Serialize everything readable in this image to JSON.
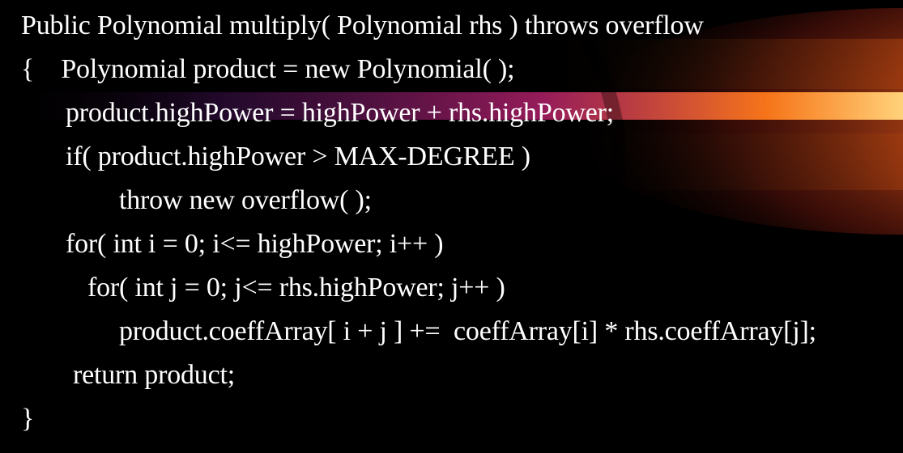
{
  "code": {
    "lines": [
      "Public Polynomial multiply( Polynomial rhs ) throws overflow",
      "{    Polynomial product = new Polynomial( );",
      "product.highPower = highPower + rhs.highPower;",
      "if( product.highPower > MAX-DEGREE )",
      "throw new overflow( );",
      "for( int i = 0; i<= highPower; i++ )",
      "for( int j = 0; j<= rhs.highPower; j++ )",
      "product.coeffArray[ i + j ] +=  coeffArray[i] * rhs.coeffArray[j];",
      "return product;",
      "}"
    ]
  },
  "colors": {
    "background": "#000000",
    "text": "#ffffff",
    "glow_core": "#fff2c0",
    "glow_orange": "#ff8a00",
    "glow_red": "#c0201a",
    "streak_magenta": "#b0206a"
  }
}
